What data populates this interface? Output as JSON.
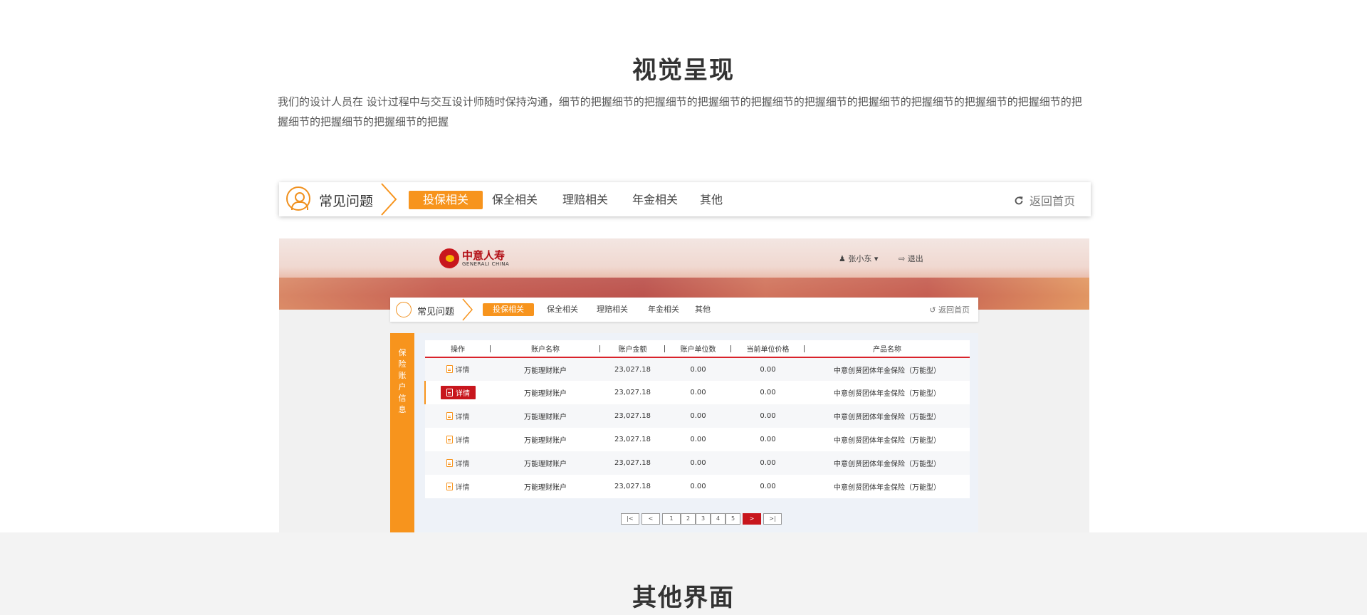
{
  "section1": {
    "title": "视觉呈现",
    "description": "我们的设计人员在 设计过程中与交互设计师随时保持沟通，细节的把握细节的把握细节的把握细节的把握细节的把握细节的把握细节的把握细节的把握细节的把握细节的把握细节的把握细节的把握细节的把握"
  },
  "navbar": {
    "title": "常见问题",
    "tabs": [
      "投保相关",
      "保全相关",
      "理赔相关",
      "年金相关",
      "其他"
    ],
    "active_tab": "投保相关",
    "home_label": "返回首页"
  },
  "app": {
    "logo_cn": "中意人寿",
    "logo_en": "GENERALI CHINA",
    "user_name": "张小东",
    "logout_label": "退出",
    "nav": {
      "title": "常见问题",
      "tabs": [
        "投保相关",
        "保全相关",
        "理赔相关",
        "年金相关",
        "其他"
      ],
      "home_label": "返回首页"
    },
    "side_label": "保险账户信息",
    "table": {
      "headers": [
        "操作",
        "账户名称",
        "账户金额",
        "账户单位数",
        "当前单位价格",
        "产品名称"
      ],
      "rows": [
        {
          "action": "详情",
          "account": "万能理财账户",
          "amount": "23,027.18",
          "units": "0.00",
          "price": "0.00",
          "product": "中意创贤团体年金保险（万能型）"
        },
        {
          "action": "详情",
          "account": "万能理财账户",
          "amount": "23,027.18",
          "units": "0.00",
          "price": "0.00",
          "product": "中意创贤团体年金保险（万能型）"
        },
        {
          "action": "详情",
          "account": "万能理财账户",
          "amount": "23,027.18",
          "units": "0.00",
          "price": "0.00",
          "product": "中意创贤团体年金保险（万能型）"
        },
        {
          "action": "详情",
          "account": "万能理财账户",
          "amount": "23,027.18",
          "units": "0.00",
          "price": "0.00",
          "product": "中意创贤团体年金保险（万能型）"
        },
        {
          "action": "详情",
          "account": "万能理财账户",
          "amount": "23,027.18",
          "units": "0.00",
          "price": "0.00",
          "product": "中意创贤团体年金保险（万能型）"
        },
        {
          "action": "详情",
          "account": "万能理财账户",
          "amount": "23,027.18",
          "units": "0.00",
          "price": "0.00",
          "product": "中意创贤团体年金保险（万能型）"
        }
      ],
      "selected_row": 2
    },
    "pager": {
      "first": "|<",
      "prev": "<",
      "pages": [
        "1",
        "2",
        "3",
        "4",
        "5"
      ],
      "next": ">",
      "last": ">|"
    }
  },
  "section2": {
    "title": "其他界面"
  },
  "colors": {
    "accent": "#f7941d",
    "brand_red": "#c8161d"
  }
}
